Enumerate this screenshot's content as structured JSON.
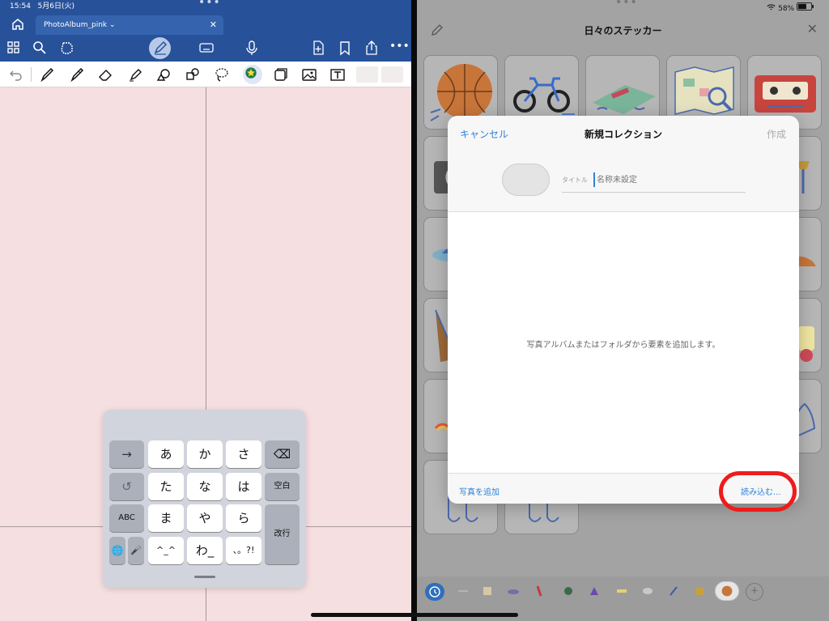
{
  "left_pane": {
    "status": {
      "time": "15:54",
      "date": "5月6日(火)",
      "dots": "•••"
    },
    "tab": {
      "title": "PhotoAlbum_pink",
      "chevron": "⌄",
      "close": "✕"
    },
    "toolbar_icons": [
      "grid-icon",
      "search-icon",
      "lasso-select-icon",
      "pen-icon",
      "keyboard-icon",
      "mic-icon",
      "add-page-icon",
      "bookmark-icon",
      "share-icon",
      "more-icon"
    ],
    "more_glyph": "•••",
    "tools": [
      "undo-icon",
      "pen-tool-icon",
      "pencil-tool-icon",
      "eraser-icon",
      "highlighter-icon",
      "shape-icon",
      "element-icon",
      "lasso-icon",
      "sticker-icon",
      "sticky-note-icon",
      "image-icon",
      "text-icon"
    ],
    "keyboard": {
      "keys": [
        {
          "id": "arrow",
          "label": "→",
          "dark": true
        },
        {
          "id": "a",
          "label": "あ"
        },
        {
          "id": "ka",
          "label": "か"
        },
        {
          "id": "sa",
          "label": "さ"
        },
        {
          "id": "backspace",
          "label": "⌫",
          "dark": true
        },
        {
          "id": "undo",
          "label": "↺",
          "dark": true
        },
        {
          "id": "ta",
          "label": "た"
        },
        {
          "id": "na",
          "label": "な"
        },
        {
          "id": "ha",
          "label": "は"
        },
        {
          "id": "space",
          "label": "空白",
          "dark": true,
          "small": true
        },
        {
          "id": "abc",
          "label": "ABC",
          "dark": true,
          "small": true
        },
        {
          "id": "ma",
          "label": "ま"
        },
        {
          "id": "ya",
          "label": "や"
        },
        {
          "id": "ra",
          "label": "ら"
        },
        {
          "id": "return",
          "label": "改行",
          "dark": true,
          "small": true
        },
        {
          "id": "globe",
          "label": "🌐",
          "dark": true
        },
        {
          "id": "mic",
          "label": "🎤",
          "dark": true
        },
        {
          "id": "emoticon",
          "label": "^_^"
        },
        {
          "id": "wa",
          "label": "わ_"
        },
        {
          "id": "punct",
          "label": "、。?!"
        }
      ]
    }
  },
  "right_pane": {
    "status": {
      "dots": "•••",
      "wifi": "WiFi",
      "battery": "58%"
    },
    "header": {
      "title": "日々のステッカー",
      "close": "✕"
    },
    "stickers": [
      "basketball-sticker",
      "bicycle-sticker",
      "dumbbell-mat-sticker",
      "map-sticker",
      "cassette-sticker"
    ],
    "modal": {
      "cancel": "キャンセル",
      "title": "新規コレクション",
      "create": "作成",
      "title_label": "タイトル",
      "title_placeholder": "名称未設定",
      "empty_message": "写真アルバムまたはフォルダから要素を追加します。",
      "add_photo": "写真を追加",
      "import": "読み込む..."
    },
    "bottom_bar": [
      "recent-icon",
      "sticker-1",
      "sticker-2",
      "sticker-3",
      "sticker-4",
      "sticker-5",
      "sticker-6",
      "sticker-7",
      "sticker-8",
      "sticker-9",
      "sticker-10",
      "sticker-11",
      "basketball-sticker-tab",
      "add-collection-icon"
    ],
    "add_glyph": "＋"
  }
}
